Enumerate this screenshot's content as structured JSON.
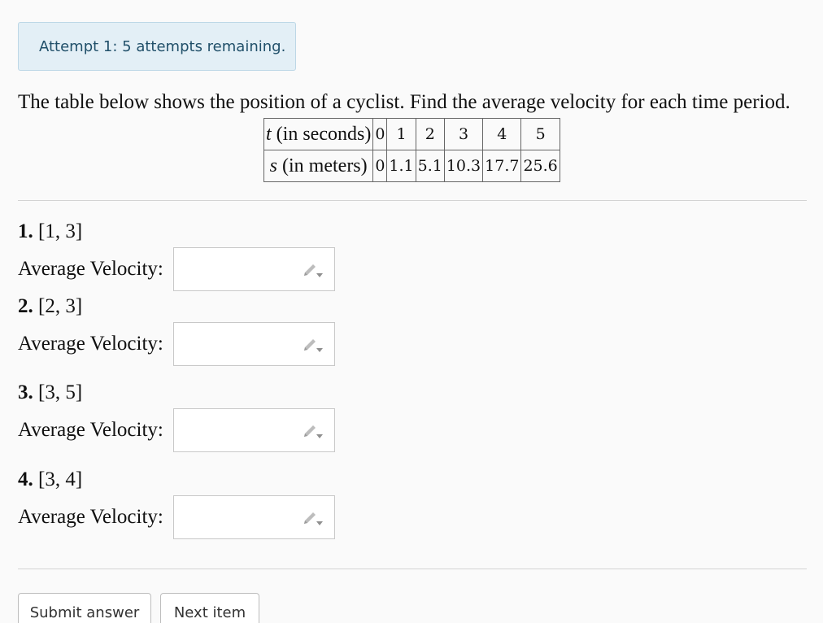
{
  "alert": {
    "text": "Attempt 1: 5 attempts remaining."
  },
  "prompt": "The table below shows the position of a cyclist. Find the average velocity for each time period.",
  "table": {
    "row_t": {
      "var": "t",
      "label": " (in seconds)",
      "values": [
        "0",
        "1",
        "2",
        "3",
        "4",
        "5"
      ]
    },
    "row_s": {
      "var": "s",
      "label": " (in meters)",
      "values": [
        "0",
        "1.1",
        "5.1",
        "10.3",
        "17.7",
        "25.6"
      ]
    }
  },
  "questions": [
    {
      "number": "1.",
      "interval": "[1, 3]",
      "label": "Average Velocity:",
      "value": ""
    },
    {
      "number": "2.",
      "interval": "[2, 3]",
      "label": "Average Velocity:",
      "value": ""
    },
    {
      "number": "3.",
      "interval": "[3, 5]",
      "label": "Average Velocity:",
      "value": ""
    },
    {
      "number": "4.",
      "interval": "[3, 4]",
      "label": "Average Velocity:",
      "value": ""
    }
  ],
  "buttons": {
    "submit": "Submit answer",
    "next": "Next item"
  },
  "icons": {
    "answer_field": "pencil-edit-icon"
  }
}
